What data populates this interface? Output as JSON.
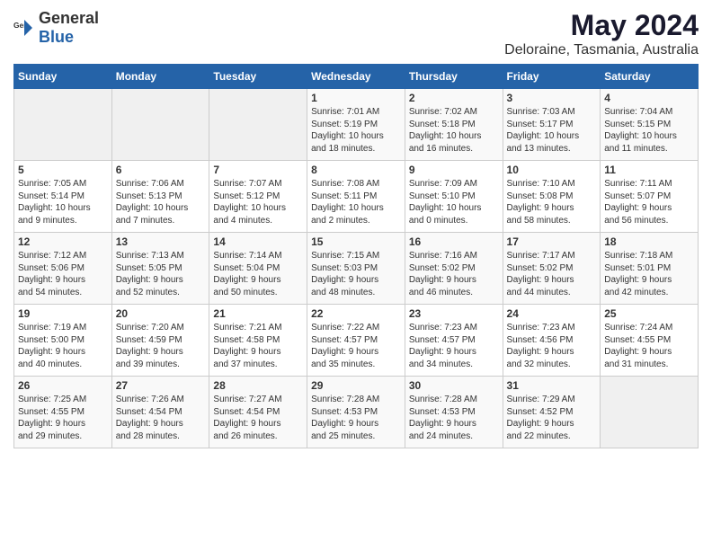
{
  "header": {
    "logo_general": "General",
    "logo_blue": "Blue",
    "title": "May 2024",
    "subtitle": "Deloraine, Tasmania, Australia"
  },
  "calendar": {
    "days_of_week": [
      "Sunday",
      "Monday",
      "Tuesday",
      "Wednesday",
      "Thursday",
      "Friday",
      "Saturday"
    ],
    "weeks": [
      [
        {
          "day": "",
          "info": ""
        },
        {
          "day": "",
          "info": ""
        },
        {
          "day": "",
          "info": ""
        },
        {
          "day": "1",
          "info": "Sunrise: 7:01 AM\nSunset: 5:19 PM\nDaylight: 10 hours\nand 18 minutes."
        },
        {
          "day": "2",
          "info": "Sunrise: 7:02 AM\nSunset: 5:18 PM\nDaylight: 10 hours\nand 16 minutes."
        },
        {
          "day": "3",
          "info": "Sunrise: 7:03 AM\nSunset: 5:17 PM\nDaylight: 10 hours\nand 13 minutes."
        },
        {
          "day": "4",
          "info": "Sunrise: 7:04 AM\nSunset: 5:15 PM\nDaylight: 10 hours\nand 11 minutes."
        }
      ],
      [
        {
          "day": "5",
          "info": "Sunrise: 7:05 AM\nSunset: 5:14 PM\nDaylight: 10 hours\nand 9 minutes."
        },
        {
          "day": "6",
          "info": "Sunrise: 7:06 AM\nSunset: 5:13 PM\nDaylight: 10 hours\nand 7 minutes."
        },
        {
          "day": "7",
          "info": "Sunrise: 7:07 AM\nSunset: 5:12 PM\nDaylight: 10 hours\nand 4 minutes."
        },
        {
          "day": "8",
          "info": "Sunrise: 7:08 AM\nSunset: 5:11 PM\nDaylight: 10 hours\nand 2 minutes."
        },
        {
          "day": "9",
          "info": "Sunrise: 7:09 AM\nSunset: 5:10 PM\nDaylight: 10 hours\nand 0 minutes."
        },
        {
          "day": "10",
          "info": "Sunrise: 7:10 AM\nSunset: 5:08 PM\nDaylight: 9 hours\nand 58 minutes."
        },
        {
          "day": "11",
          "info": "Sunrise: 7:11 AM\nSunset: 5:07 PM\nDaylight: 9 hours\nand 56 minutes."
        }
      ],
      [
        {
          "day": "12",
          "info": "Sunrise: 7:12 AM\nSunset: 5:06 PM\nDaylight: 9 hours\nand 54 minutes."
        },
        {
          "day": "13",
          "info": "Sunrise: 7:13 AM\nSunset: 5:05 PM\nDaylight: 9 hours\nand 52 minutes."
        },
        {
          "day": "14",
          "info": "Sunrise: 7:14 AM\nSunset: 5:04 PM\nDaylight: 9 hours\nand 50 minutes."
        },
        {
          "day": "15",
          "info": "Sunrise: 7:15 AM\nSunset: 5:03 PM\nDaylight: 9 hours\nand 48 minutes."
        },
        {
          "day": "16",
          "info": "Sunrise: 7:16 AM\nSunset: 5:02 PM\nDaylight: 9 hours\nand 46 minutes."
        },
        {
          "day": "17",
          "info": "Sunrise: 7:17 AM\nSunset: 5:02 PM\nDaylight: 9 hours\nand 44 minutes."
        },
        {
          "day": "18",
          "info": "Sunrise: 7:18 AM\nSunset: 5:01 PM\nDaylight: 9 hours\nand 42 minutes."
        }
      ],
      [
        {
          "day": "19",
          "info": "Sunrise: 7:19 AM\nSunset: 5:00 PM\nDaylight: 9 hours\nand 40 minutes."
        },
        {
          "day": "20",
          "info": "Sunrise: 7:20 AM\nSunset: 4:59 PM\nDaylight: 9 hours\nand 39 minutes."
        },
        {
          "day": "21",
          "info": "Sunrise: 7:21 AM\nSunset: 4:58 PM\nDaylight: 9 hours\nand 37 minutes."
        },
        {
          "day": "22",
          "info": "Sunrise: 7:22 AM\nSunset: 4:57 PM\nDaylight: 9 hours\nand 35 minutes."
        },
        {
          "day": "23",
          "info": "Sunrise: 7:23 AM\nSunset: 4:57 PM\nDaylight: 9 hours\nand 34 minutes."
        },
        {
          "day": "24",
          "info": "Sunrise: 7:23 AM\nSunset: 4:56 PM\nDaylight: 9 hours\nand 32 minutes."
        },
        {
          "day": "25",
          "info": "Sunrise: 7:24 AM\nSunset: 4:55 PM\nDaylight: 9 hours\nand 31 minutes."
        }
      ],
      [
        {
          "day": "26",
          "info": "Sunrise: 7:25 AM\nSunset: 4:55 PM\nDaylight: 9 hours\nand 29 minutes."
        },
        {
          "day": "27",
          "info": "Sunrise: 7:26 AM\nSunset: 4:54 PM\nDaylight: 9 hours\nand 28 minutes."
        },
        {
          "day": "28",
          "info": "Sunrise: 7:27 AM\nSunset: 4:54 PM\nDaylight: 9 hours\nand 26 minutes."
        },
        {
          "day": "29",
          "info": "Sunrise: 7:28 AM\nSunset: 4:53 PM\nDaylight: 9 hours\nand 25 minutes."
        },
        {
          "day": "30",
          "info": "Sunrise: 7:28 AM\nSunset: 4:53 PM\nDaylight: 9 hours\nand 24 minutes."
        },
        {
          "day": "31",
          "info": "Sunrise: 7:29 AM\nSunset: 4:52 PM\nDaylight: 9 hours\nand 22 minutes."
        },
        {
          "day": "",
          "info": ""
        }
      ]
    ]
  }
}
